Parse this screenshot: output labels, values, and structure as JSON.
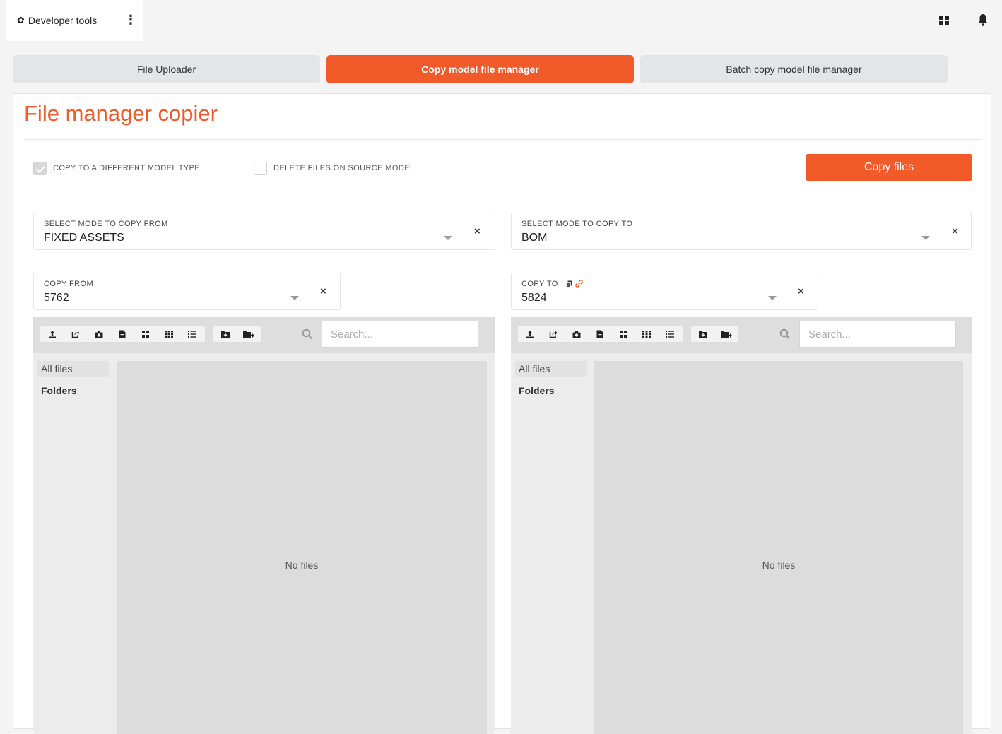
{
  "app": {
    "title": "Developer tools",
    "menu_glyph": "⋮",
    "gear_glyph": "✿"
  },
  "tabs": [
    {
      "label": "File Uploader",
      "active": false
    },
    {
      "label": "Copy model file manager",
      "active": true
    },
    {
      "label": "Batch copy model file manager",
      "active": false
    }
  ],
  "page": {
    "title": "File manager copier",
    "options": {
      "copy_different_type": {
        "label": "COPY TO A DIFFERENT MODEL TYPE",
        "checked": true
      },
      "delete_source": {
        "label": "DELETE FILES ON SOURCE MODEL",
        "checked": false
      }
    },
    "copy_button": "Copy files"
  },
  "source": {
    "mode_label": "SELECT MODE TO COPY FROM",
    "mode_value": "FIXED ASSETS",
    "model_label": "COPY FROM",
    "model_value": "5762",
    "search_placeholder": "Search...",
    "sidebar_all": "All files",
    "sidebar_folders": "Folders",
    "empty_text": "No files"
  },
  "target": {
    "mode_label": "SELECT MODE TO COPY TO",
    "mode_value": "BOM",
    "model_label": "COPY TO",
    "model_value": "5824",
    "search_placeholder": "Search...",
    "sidebar_all": "All files",
    "sidebar_folders": "Folders",
    "empty_text": "No files"
  },
  "symbols": {
    "clear": "×"
  },
  "colors": {
    "accent": "#f15a29",
    "tab_inactive": "#e4e5e7",
    "panel": "#ececec"
  }
}
